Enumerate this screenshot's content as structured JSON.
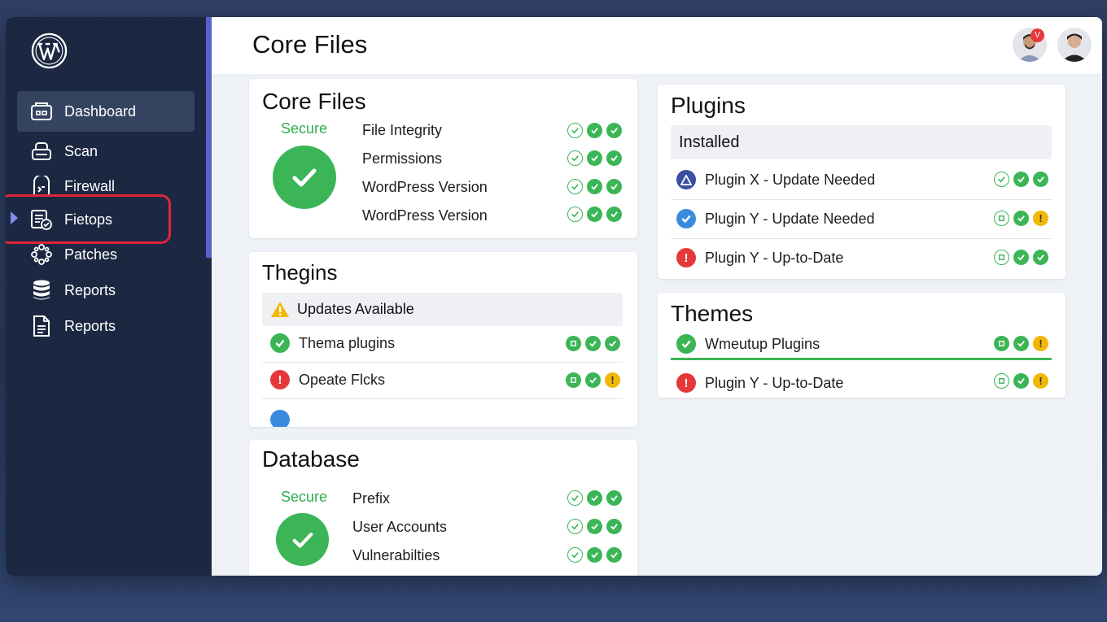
{
  "sidebar": {
    "items": [
      {
        "label": "Dashboard",
        "icon": "dashboard-icon",
        "active": true
      },
      {
        "label": "Scan",
        "icon": "scan-icon"
      },
      {
        "label": "Firewall",
        "icon": "firewall-icon"
      },
      {
        "label": "Fietops",
        "icon": "file-check-icon",
        "highlighted": true
      },
      {
        "label": "Patches",
        "icon": "patches-icon"
      },
      {
        "label": "Reports",
        "icon": "database-icon"
      },
      {
        "label": "Reports",
        "icon": "report-document-icon"
      }
    ]
  },
  "header": {
    "title": "Core Files",
    "notification_badge": "V"
  },
  "core_files": {
    "title": "Core Files",
    "status": "Secure",
    "rows": [
      "File Integrity",
      "Permissions",
      "WordPress Version",
      "WordPress Version"
    ]
  },
  "thegins": {
    "title": "Thegins",
    "subhead": "Updates Available",
    "rows": [
      {
        "label": "Thema plugins",
        "icon": "check"
      },
      {
        "label": "Opeate Flcks",
        "icon": "error"
      }
    ]
  },
  "database": {
    "title": "Database",
    "status": "Secure",
    "rows": [
      "Prefix",
      "User Accounts",
      "Vulnerabilties"
    ]
  },
  "plugins": {
    "title": "Plugins",
    "subhead": "Installed",
    "rows": [
      {
        "label": "Plugin X - Update Needed",
        "icon": "triangle"
      },
      {
        "label": "Plugin Y - Update Needed",
        "icon": "check-blue"
      },
      {
        "label": "Plugin Y - Up-to-Date",
        "icon": "error"
      }
    ]
  },
  "themes": {
    "title": "Themes",
    "rows": [
      {
        "label": "Wmeutup Plugins",
        "icon": "check"
      },
      {
        "label": "Plugin Y - Up-to-Date",
        "icon": "error"
      }
    ]
  },
  "colors": {
    "accent": "#5563c9",
    "success": "#3bb556",
    "warning": "#f2b705",
    "danger": "#e5383b",
    "sidebar": "#1c2842"
  }
}
